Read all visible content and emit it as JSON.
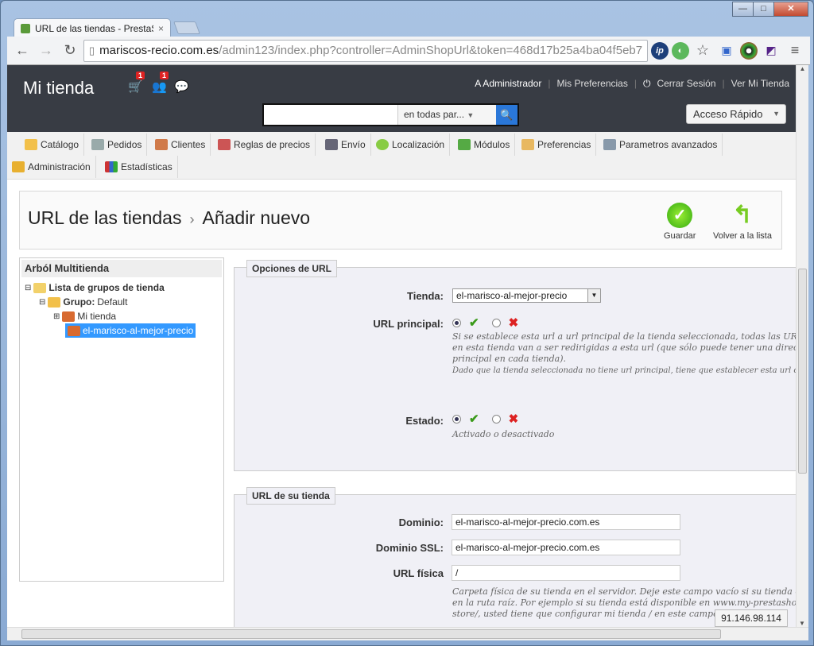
{
  "browser": {
    "tab_title": "URL de las tiendas - PrestaS",
    "tab_close": "×",
    "url_host": "mariscos-recio.com.es",
    "url_path": "/admin123/index.php?controller=AdminShopUrl&token=468d17b25a4ba04f5eb7",
    "window_buttons": {
      "minimize": "—",
      "maximize": "□",
      "close": "✕"
    }
  },
  "header": {
    "shop_name": "Mi tienda",
    "cart_badge": "1",
    "customers_badge": "1",
    "admin_label": "A Administrador",
    "preferences_link": "Mis Preferencias",
    "logout_link": "Cerrar Sesión",
    "view_shop_link": "Ver Mi Tienda",
    "search_scope": "en todas par...",
    "quick_access": "Acceso Rápido"
  },
  "menu": {
    "items": [
      "Catálogo",
      "Pedidos",
      "Clientes",
      "Reglas de precios",
      "Envío",
      "Localización",
      "Módulos",
      "Preferencias",
      "Parametros avanzados",
      "Administración",
      "Estadísticas"
    ]
  },
  "breadcrumb": {
    "section": "URL de las tiendas",
    "arrow": "›",
    "current": "Añadir nuevo"
  },
  "actions": {
    "save": "Guardar",
    "back": "Volver a la lista"
  },
  "tree": {
    "title": "Arból Multitienda",
    "root": "Lista de grupos de tienda",
    "group_label": "Grupo:",
    "group_name": "Default",
    "shop1": "Mi tienda",
    "shop2": "el-marisco-al-mejor-precio"
  },
  "url_options": {
    "legend": "Opciones de URL",
    "shop_label": "Tienda:",
    "shop_value": "el-marisco-al-mejor-precio",
    "main_url_label": "URL principal:",
    "main_url_hint1": "Si se establece esta url a url principal de la tienda seleccionada, todas las URLs",
    "main_url_hint2": "en esta tienda van a ser redirigidas a esta url (que sólo puede tener una direcció",
    "main_url_hint3": "principal en cada tienda).",
    "main_url_hint4": "Dado que la tienda seleccionada no tiene url principal, tiene que establecer esta url com",
    "status_label": "Estado:",
    "status_hint": "Activado o desactivado"
  },
  "shop_url": {
    "legend": "URL de su tienda",
    "domain_label": "Dominio:",
    "domain_value": "el-marisco-al-mejor-precio.com.es",
    "ssl_label": "Dominio SSL:",
    "ssl_value": "el-marisco-al-mejor-precio.com.es",
    "physical_label": "URL física",
    "physical_value": "/",
    "physical_hint1": "Carpeta física de su tienda en el servidor. Deje este campo vacío si su tienda est",
    "physical_hint2": "en la ruta raíz. Por ejemplo si su tienda está disponible en www.my-prestasho",
    "physical_hint3": "store/, usted tiene que configurar mi tienda / en este campo."
  },
  "status_bar": {
    "ip": "91.146.98.114"
  },
  "colors": {
    "header_bg": "#383c44",
    "search_button": "#2a77d8",
    "selected_node": "#3399ff",
    "ok_green": "#3a9a1a",
    "no_red": "#dd2222"
  }
}
